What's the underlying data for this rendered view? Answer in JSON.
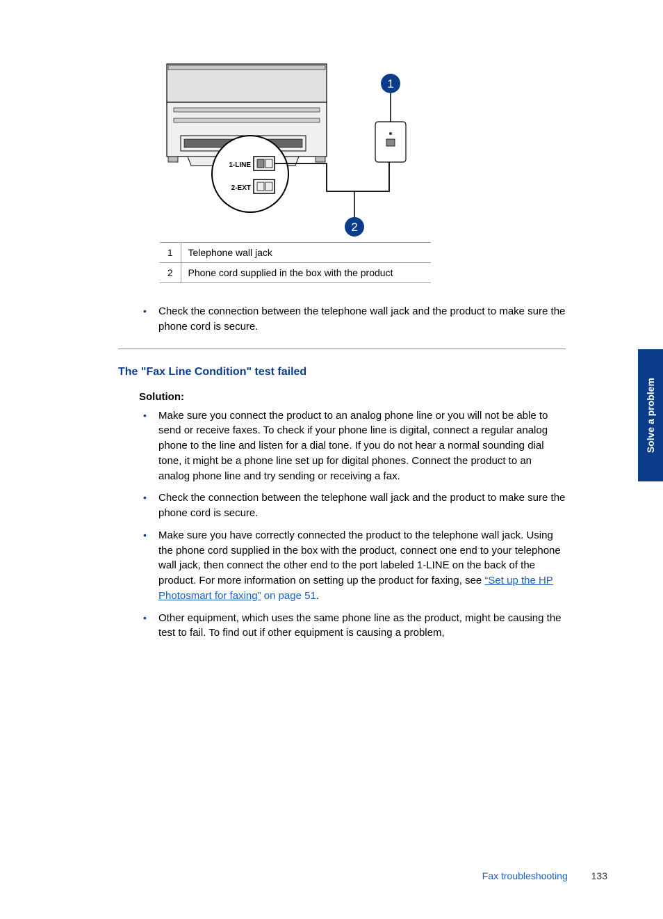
{
  "sidebar": {
    "tab_label": "Solve a problem"
  },
  "diagram": {
    "port_label_1": "1-LINE",
    "port_label_2": "2-EXT",
    "callout_1": "1",
    "callout_2": "2"
  },
  "legend": [
    {
      "num": "1",
      "text": "Telephone wall jack"
    },
    {
      "num": "2",
      "text": "Phone cord supplied in the box with the product"
    }
  ],
  "top_bullets": [
    "Check the connection between the telephone wall jack and the product to make sure the phone cord is secure."
  ],
  "section_heading": "The \"Fax Line Condition\" test failed",
  "solution_label": "Solution:",
  "solution_bullets": [
    {
      "text": "Make sure you connect the product to an analog phone line or you will not be able to send or receive faxes. To check if your phone line is digital, connect a regular analog phone to the line and listen for a dial tone. If you do not hear a normal sounding dial tone, it might be a phone line set up for digital phones. Connect the product to an analog phone line and try sending or receiving a fax."
    },
    {
      "text": "Check the connection between the telephone wall jack and the product to make sure the phone cord is secure."
    },
    {
      "text_before": "Make sure you have correctly connected the product to the telephone wall jack. Using the phone cord supplied in the box with the product, connect one end to your telephone wall jack, then connect the other end to the port labeled 1-LINE on the back of the product. For more information on setting up the product for faxing, see ",
      "link_text": "“Set up the HP Photosmart for faxing”",
      "text_after_link": " on page 51",
      "text_end": "."
    },
    {
      "text": "Other equipment, which uses the same phone line as the product, might be causing the test to fail. To find out if other equipment is causing a problem,"
    }
  ],
  "footer": {
    "section": "Fax troubleshooting",
    "page": "133"
  }
}
